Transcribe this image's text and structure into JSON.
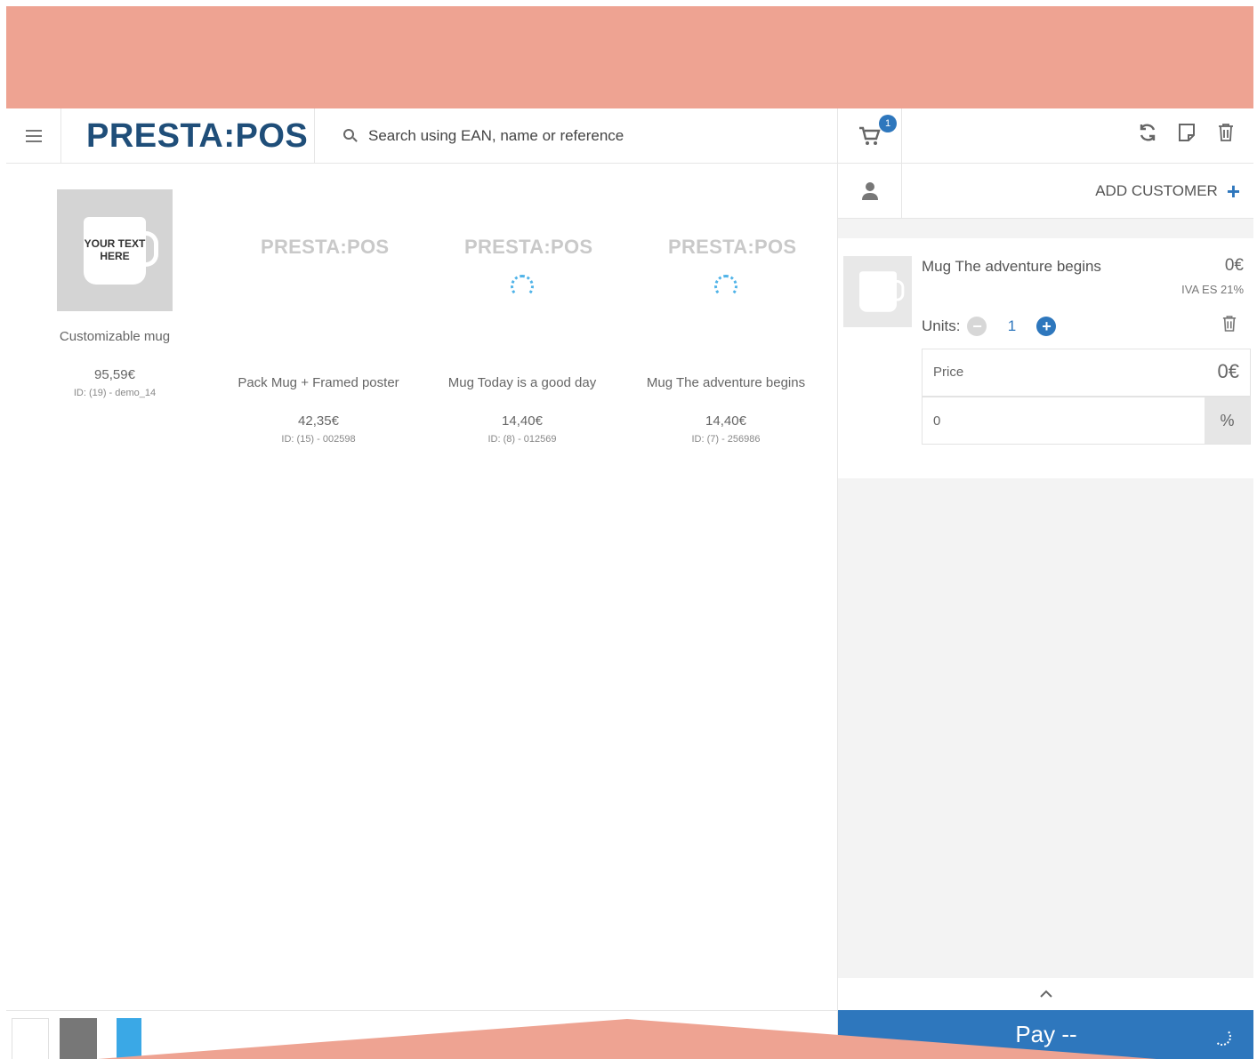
{
  "app": {
    "logo": "PRESTA:POS"
  },
  "search": {
    "placeholder": "Search using EAN, name or reference"
  },
  "cart": {
    "badge": "1",
    "add_customer": "ADD CUSTOMER",
    "line": {
      "name": "Mug The adventure begins",
      "price": "0€",
      "tax": "IVA ES 21%",
      "units_label": "Units:",
      "quantity": "1",
      "price_field_label": "Price",
      "price_field_value": "0€",
      "discount_value": "0",
      "discount_unit": "%"
    },
    "pay_label": "Pay --"
  },
  "products": [
    {
      "name": "Customizable mug",
      "price": "95,59€",
      "ref": "ID: (19) - demo_14",
      "image": "photo",
      "mug_text": "YOUR TEXT HERE"
    },
    {
      "name": "Pack Mug + Framed poster",
      "price": "42,35€",
      "ref": "ID: (15) - 002598",
      "image": "placeholder",
      "placeholder_text": "PRESTA:POS"
    },
    {
      "name": "Mug Today is a good day",
      "price": "14,40€",
      "ref": "ID: (8) - 012569",
      "image": "loading",
      "placeholder_text": "PRESTA:POS"
    },
    {
      "name": "Mug The adventure begins",
      "price": "14,40€",
      "ref": "ID: (7) - 256986",
      "image": "loading",
      "placeholder_text": "PRESTA:POS"
    }
  ],
  "colors": {
    "accent": "#2e77bd",
    "banner": "#eea392",
    "logo": "#1f4e79",
    "loader": "#4fb3e8"
  },
  "icons": [
    "menu-icon",
    "search-icon",
    "cart-icon",
    "refresh-icon",
    "note-icon",
    "trash-icon",
    "user-icon",
    "plus-icon",
    "minus-icon",
    "chevron-up-icon",
    "spinner-icon"
  ]
}
